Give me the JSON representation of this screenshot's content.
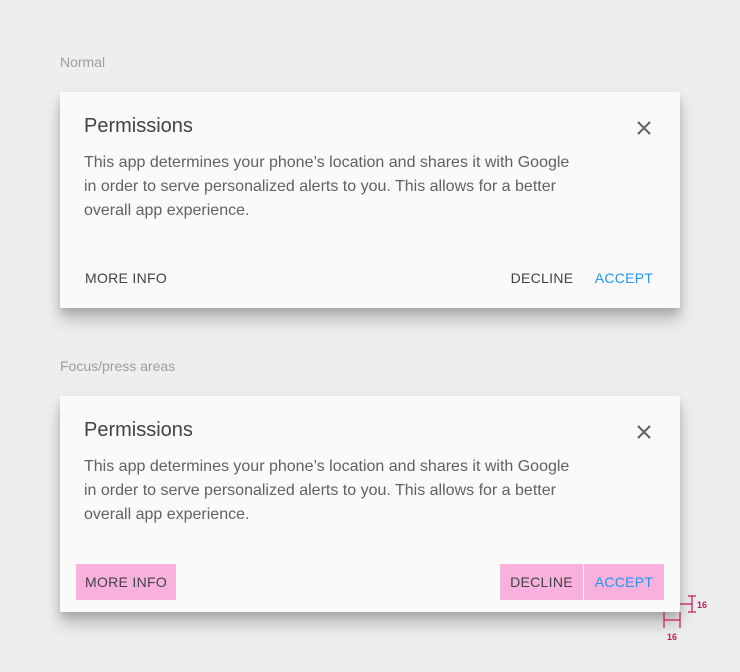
{
  "sections": {
    "normal_label": "Normal",
    "focus_label": "Focus/press areas"
  },
  "dialog": {
    "title": "Permissions",
    "body": "This app determines your phone’s location and shares it with Google in order to serve personalized alerts to you. This allows for a better overall app experience.",
    "close_icon": "close-icon",
    "buttons": {
      "more_info": "MORE INFO",
      "decline": "DECLINE",
      "accept": "ACCEPT"
    }
  },
  "annotations": {
    "right_spacing": "16",
    "bottom_spacing": "16"
  },
  "colors": {
    "background": "#eeeeee",
    "dialog_surface": "#fafafa",
    "accent": "#2196f3",
    "focus_highlight": "#f8b0dc",
    "annotation": "#c2185b"
  }
}
